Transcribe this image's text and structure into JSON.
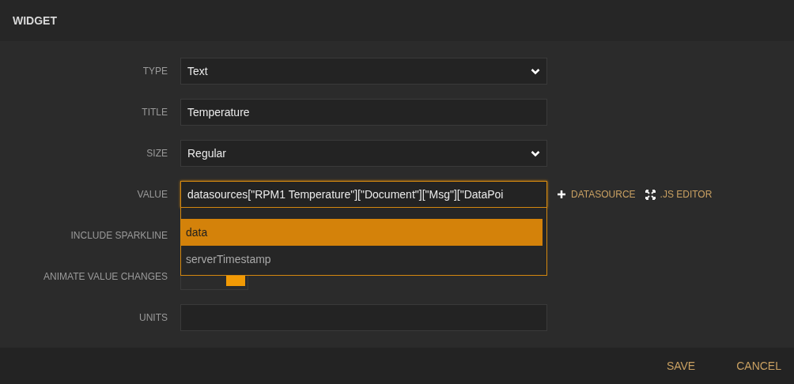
{
  "window": {
    "title": "WIDGET"
  },
  "fields": [
    {
      "kind": "select",
      "label": "TYPE",
      "value": "Text"
    },
    {
      "kind": "text",
      "label": "TITLE",
      "value": "Temperature"
    },
    {
      "kind": "select",
      "label": "SIZE",
      "value": "Regular"
    },
    {
      "kind": "value",
      "label": "VALUE",
      "value": "datasources[\"RPM1 Temperature\"][\"Document\"][\"Msg\"][\"DataPoi",
      "actions": [
        {
          "kind": "add",
          "label": "DATASOURCE"
        },
        {
          "kind": "expand",
          "label": ".JS EDITOR"
        }
      ],
      "suggestions": [
        {
          "label": "data",
          "selected": true
        },
        {
          "label": "serverTimestamp",
          "selected": false
        }
      ]
    },
    {
      "kind": "hidden",
      "label": "INCLUDE SPARKLINE"
    },
    {
      "kind": "toggle",
      "label": "ANIMATE VALUE CHANGES",
      "on": true
    },
    {
      "kind": "text",
      "label": "UNITS"
    }
  ],
  "buttons": [
    "SAVE",
    "CANCEL"
  ]
}
